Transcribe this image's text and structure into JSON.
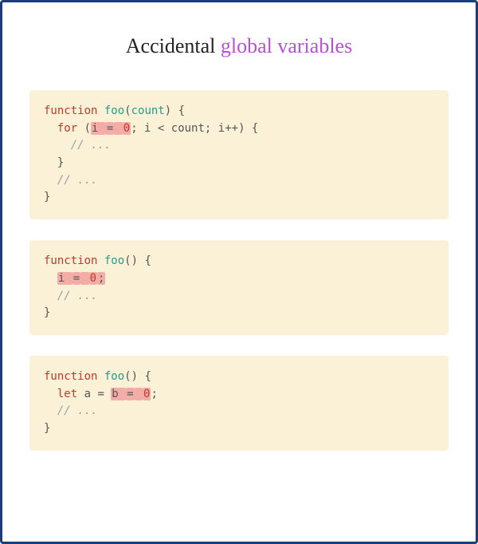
{
  "title": {
    "part1": "Accidental ",
    "part2": "global variables"
  },
  "blocks": [
    {
      "tokens": [
        {
          "t": "function ",
          "c": "kw"
        },
        {
          "t": "foo",
          "c": "fn"
        },
        {
          "t": "(",
          "c": "pn"
        },
        {
          "t": "count",
          "c": "id"
        },
        {
          "t": ") {",
          "c": "pn"
        },
        {
          "t": "\n  ",
          "c": ""
        },
        {
          "t": "for ",
          "c": "kw"
        },
        {
          "t": "(",
          "c": "pn"
        },
        {
          "t": "i ",
          "c": "var",
          "hl": true
        },
        {
          "t": "=",
          "c": "pn",
          "hl": true
        },
        {
          "t": " ",
          "c": "",
          "hl": true
        },
        {
          "t": "0",
          "c": "num",
          "hl": true
        },
        {
          "t": "; i ",
          "c": "var"
        },
        {
          "t": "<",
          "c": "pn"
        },
        {
          "t": " count; i",
          "c": "var"
        },
        {
          "t": "++",
          "c": "pn"
        },
        {
          "t": ") {",
          "c": "pn"
        },
        {
          "t": "\n    ",
          "c": ""
        },
        {
          "t": "// ...",
          "c": "cm"
        },
        {
          "t": "\n  }",
          "c": "pn"
        },
        {
          "t": "\n  ",
          "c": ""
        },
        {
          "t": "// ...",
          "c": "cm"
        },
        {
          "t": "\n}",
          "c": "pn"
        }
      ]
    },
    {
      "tokens": [
        {
          "t": "function ",
          "c": "kw"
        },
        {
          "t": "foo",
          "c": "fn"
        },
        {
          "t": "() {",
          "c": "pn"
        },
        {
          "t": "\n  ",
          "c": ""
        },
        {
          "t": "i ",
          "c": "var",
          "hl": true
        },
        {
          "t": "=",
          "c": "pn",
          "hl": true
        },
        {
          "t": " ",
          "c": "",
          "hl": true
        },
        {
          "t": "0",
          "c": "num",
          "hl": true
        },
        {
          "t": ";",
          "c": "pn",
          "hl": true
        },
        {
          "t": "\n  ",
          "c": ""
        },
        {
          "t": "// ...",
          "c": "cm"
        },
        {
          "t": "\n}",
          "c": "pn"
        }
      ]
    },
    {
      "tokens": [
        {
          "t": "function ",
          "c": "kw"
        },
        {
          "t": "foo",
          "c": "fn"
        },
        {
          "t": "() {",
          "c": "pn"
        },
        {
          "t": "\n  ",
          "c": ""
        },
        {
          "t": "let ",
          "c": "kw"
        },
        {
          "t": "a ",
          "c": "var"
        },
        {
          "t": "= ",
          "c": "pn"
        },
        {
          "t": "b ",
          "c": "var",
          "hl": true
        },
        {
          "t": "=",
          "c": "pn",
          "hl": true
        },
        {
          "t": " ",
          "c": "",
          "hl": true
        },
        {
          "t": "0",
          "c": "num",
          "hl": true
        },
        {
          "t": ";",
          "c": "pn"
        },
        {
          "t": "\n  ",
          "c": ""
        },
        {
          "t": "// ...",
          "c": "cm"
        },
        {
          "t": "\n}",
          "c": "pn"
        }
      ]
    }
  ]
}
